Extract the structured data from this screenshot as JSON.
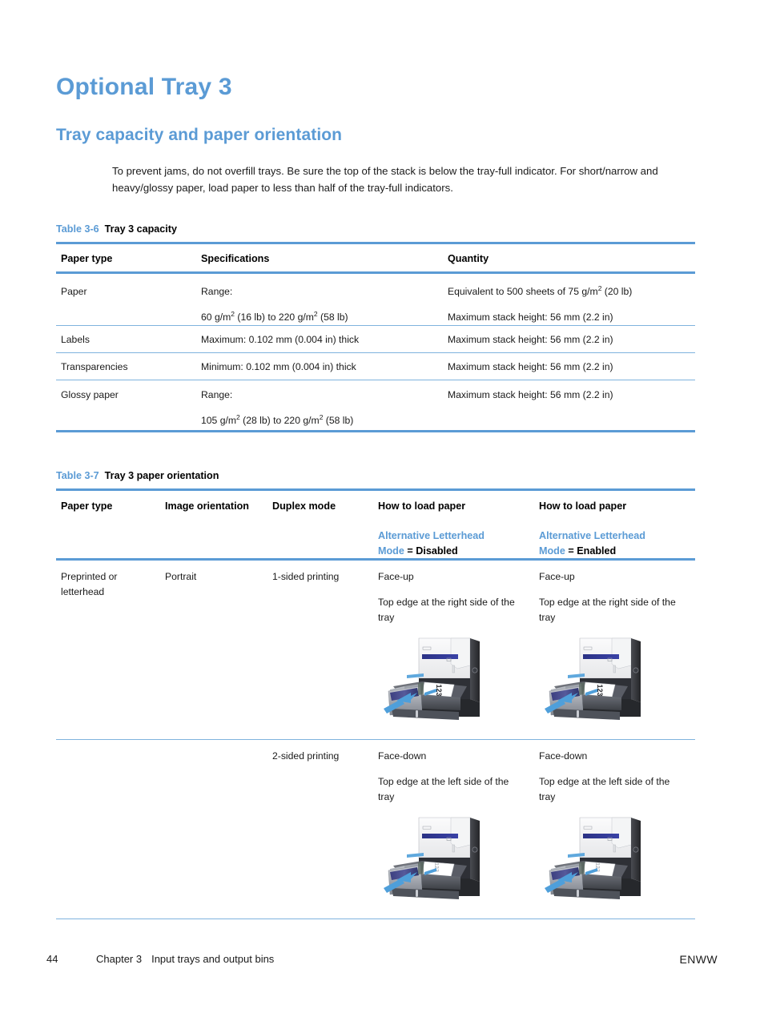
{
  "page": {
    "heading1": "Optional Tray 3",
    "heading2": "Tray capacity and paper orientation",
    "intro": "To prevent jams, do not overfill trays. Be sure the top of the stack is below the tray-full indicator. For short/narrow and heavy/glossy paper, load paper to less than half of the tray-full indicators."
  },
  "table36": {
    "caption_number": "Table 3-6",
    "caption_title": "Tray 3 capacity",
    "headers": [
      "Paper type",
      "Specifications",
      "Quantity"
    ],
    "rows": [
      {
        "paper_type": "Paper",
        "spec_line1": "Range:",
        "spec_line2_pre": "60 g/m",
        "spec_line2_sup": "2",
        "spec_line2_mid": " (16 lb) to 220 g/m",
        "spec_line2_sup2": "2",
        "spec_line2_post": " (58 lb)",
        "qty_line1_pre": "Equivalent to 500 sheets of 75 g/m",
        "qty_line1_sup": "2",
        "qty_line1_post": " (20 lb)",
        "qty_line2": "Maximum stack height: 56 mm (2.2 in)"
      },
      {
        "paper_type": "Labels",
        "spec_line1": "Maximum: 0.102 mm (0.004 in) thick",
        "qty_line1": "Maximum stack height: 56 mm (2.2 in)"
      },
      {
        "paper_type": "Transparencies",
        "spec_line1": "Minimum: 0.102 mm (0.004 in) thick",
        "qty_line1": "Maximum stack height: 56 mm (2.2 in)"
      },
      {
        "paper_type": "Glossy paper",
        "spec_line1": "Range:",
        "spec_line2_pre": "105 g/m",
        "spec_line2_sup": "2",
        "spec_line2_mid": " (28 lb) to 220 g/m",
        "spec_line2_sup2": "2",
        "spec_line2_post": " (58 lb)",
        "qty_line1": "Maximum stack height: 56 mm (2.2 in)"
      }
    ]
  },
  "table37": {
    "caption_number": "Table 3-7",
    "caption_title": "Tray 3 paper orientation",
    "headers": {
      "paper_type": "Paper type",
      "image_orientation": "Image orientation",
      "duplex_mode": "Duplex mode",
      "how_to_load_1": "How to load paper",
      "how_to_load_2": "How to load paper",
      "alm_label": "Alternative Letterhead Mode",
      "alm_label_part1": "Alternative Letterhead",
      "alm_label_part2": "Mode",
      "alm_disabled_eq": " = ",
      "alm_disabled_value": "Disabled",
      "alm_enabled_value": "Enabled"
    },
    "rows": [
      {
        "paper_type": "Preprinted or letterhead",
        "image_orientation": "Portrait",
        "duplex_mode": "1-sided printing",
        "disabled_line1": "Face-up",
        "disabled_line2": "Top edge at the right side of the tray",
        "enabled_line1": "Face-up",
        "enabled_line2": "Top edge at the right side of the tray",
        "figure_caption": "printer-tray-open-face-up"
      },
      {
        "paper_type": "",
        "image_orientation": "",
        "duplex_mode": "2-sided printing",
        "disabled_line1": "Face-down",
        "disabled_line2": "Top edge at the left side of the tray",
        "enabled_line1": "Face-down",
        "enabled_line2": "Top edge at the left side of the tray",
        "figure_caption": "printer-tray-open-face-down"
      }
    ]
  },
  "footer": {
    "page_number": "44",
    "chapter_label": "Chapter 3",
    "chapter_title": "Input trays and output bins",
    "right": "ENWW"
  },
  "colors": {
    "accent_blue": "#5b9bd5",
    "rule_blue": "#7fb3de",
    "text": "#1a1a1a"
  }
}
